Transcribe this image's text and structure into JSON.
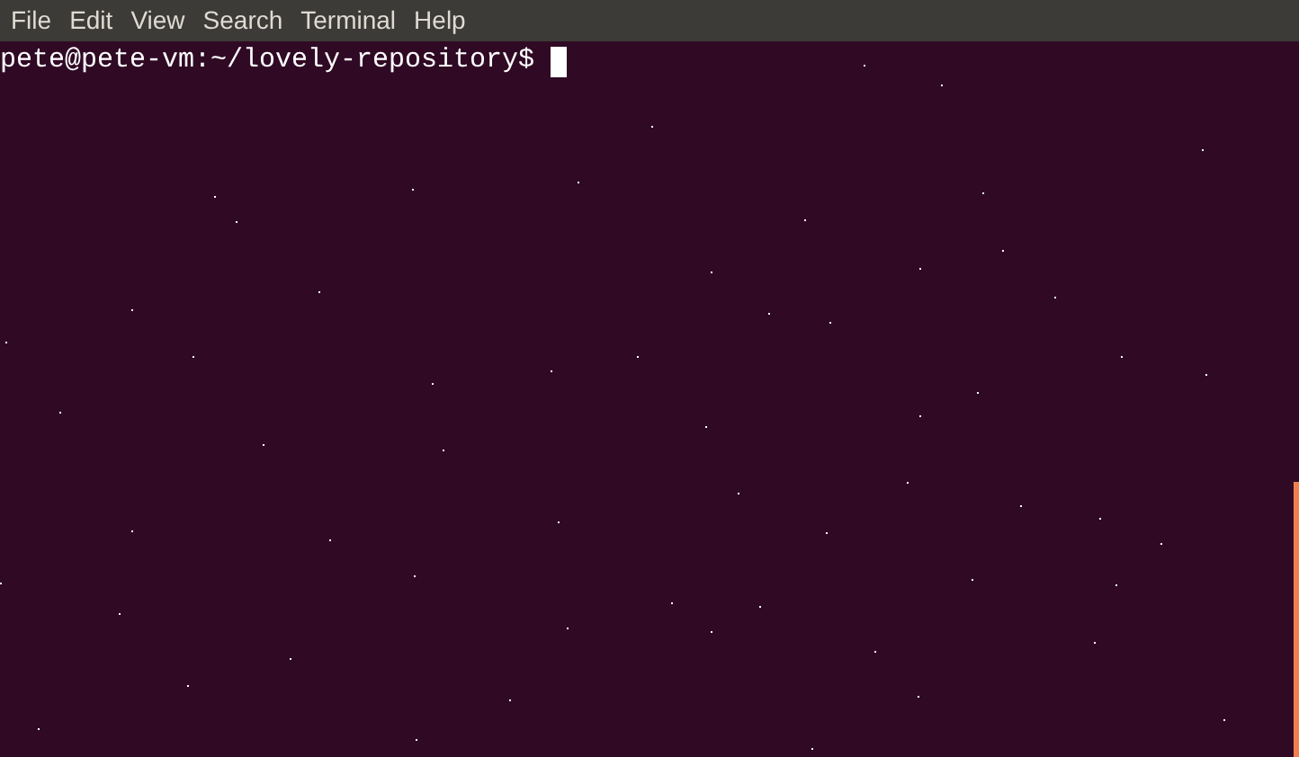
{
  "menu_bar": [
    "File",
    "Edit",
    "View",
    "Search",
    "Terminal",
    "Help"
  ],
  "terminal": {
    "prompt": "pete@pete-vm:~/lovely-repository$"
  }
}
